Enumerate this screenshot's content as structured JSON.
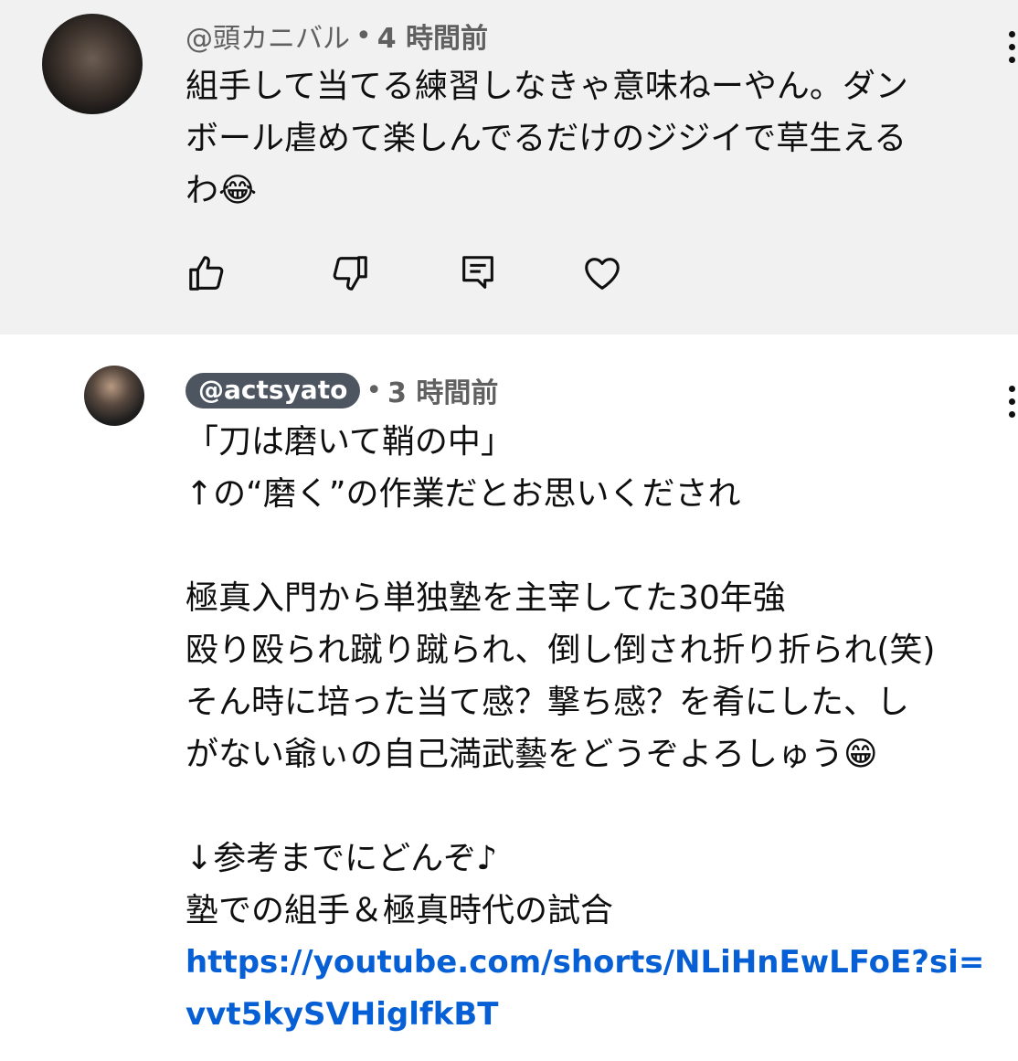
{
  "comments": [
    {
      "handle": "@頭カニバル",
      "time": "4 時間前",
      "text": "組手して当てる練習しなきゃ意味ねーやん。ダン\nボール虐めて楽しんでるだけのジジイで草生える\nわ😂",
      "actions": [
        "like-icon",
        "dislike-icon",
        "reply-icon",
        "heart-icon"
      ]
    },
    {
      "handle": "@actsyato",
      "time": "3 時間前",
      "text": "「刀は磨いて鞘の中」\n↑の“磨く”の作業だとお思いくだされ\n\n極真入門から単独塾を主宰してた30年強\n殴り殴られ蹴り蹴られ、倒し倒され折り折られ(笑)\nそん時に培った当て感？撃ち感？を肴にした、し\nがない爺ぃの自己満武藝をどうぞよろしゅう😁\n\n↓参考までにどんぞ♪\n塾での組手＆極真時代の試合",
      "link": "https://youtube.com/shorts/NLiHnEwLFoE?si=\nvvt5kySVHiglfkBT"
    }
  ],
  "separator": "•",
  "colors": {
    "highlight_bg": "#f1f1f1",
    "link": "#065fd4",
    "handle_chip": "#4d5560",
    "meta_text": "#606060"
  }
}
